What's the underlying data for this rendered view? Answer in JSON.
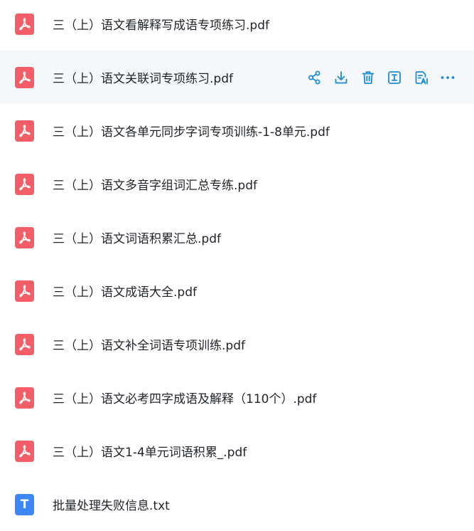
{
  "files": [
    {
      "name": "三（上）语文看解释写成语专项练习.pdf",
      "type": "pdf"
    },
    {
      "name": "三（上）语文关联词专项练习.pdf",
      "type": "pdf"
    },
    {
      "name": "三（上）语文各单元同步字词专项训练-1-8单元.pdf",
      "type": "pdf"
    },
    {
      "name": "三（上）语文多音字组词汇总专练.pdf",
      "type": "pdf"
    },
    {
      "name": "三（上）语文词语积累汇总.pdf",
      "type": "pdf"
    },
    {
      "name": "三（上）语文成语大全.pdf",
      "type": "pdf"
    },
    {
      "name": "三（上）语文补全词语专项训练.pdf",
      "type": "pdf"
    },
    {
      "name": "三（上）语文必考四字成语及解释（110个）.pdf",
      "type": "pdf"
    },
    {
      "name": "三（上）语文1-4单元词语积累_.pdf",
      "type": "pdf"
    },
    {
      "name": "批量处理失败信息.txt",
      "type": "txt"
    }
  ],
  "txt_icon_letter": "T",
  "hovered_row_index": 1,
  "hover_actions": [
    {
      "icon": "share-icon"
    },
    {
      "icon": "download-icon"
    },
    {
      "icon": "delete-icon"
    },
    {
      "icon": "text-recognition-icon"
    },
    {
      "icon": "ai-document-icon"
    },
    {
      "icon": "more-icon"
    }
  ],
  "colors": {
    "pdf_icon": "#f25d67",
    "txt_icon": "#3d86f5",
    "action_icon": "#1a8cd8",
    "hover_background": "#f5f7fa"
  }
}
